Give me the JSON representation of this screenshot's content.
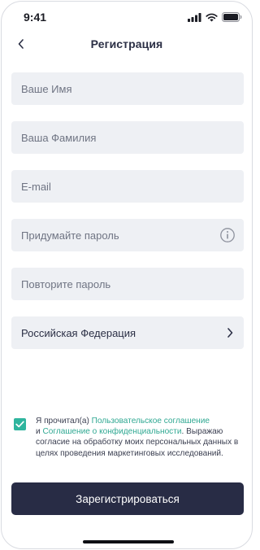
{
  "status_bar": {
    "time": "9:41"
  },
  "header": {
    "title": "Регистрация"
  },
  "form": {
    "first_name_placeholder": "Ваше Имя",
    "last_name_placeholder": "Ваша Фамилия",
    "email_placeholder": "E-mail",
    "password_placeholder": "Придумайте пароль",
    "repeat_password_placeholder": "Повторите пароль",
    "country_label": "Российская Федерация"
  },
  "consent": {
    "checked": true,
    "prefix": "Я прочитал(а) ",
    "user_agreement_link": "Пользовательское соглашение",
    "middle": "и ",
    "privacy_link": "Соглашение о конфиденциальности",
    "suffix": ". Выражаю согласие на обработку моих персональных данных в целях проведения маркетинговых исследований."
  },
  "register_button_label": "Зарегистрироваться",
  "colors": {
    "accent": "#2fb59e",
    "button": "#282c45",
    "field_bg": "#eef0f4"
  }
}
